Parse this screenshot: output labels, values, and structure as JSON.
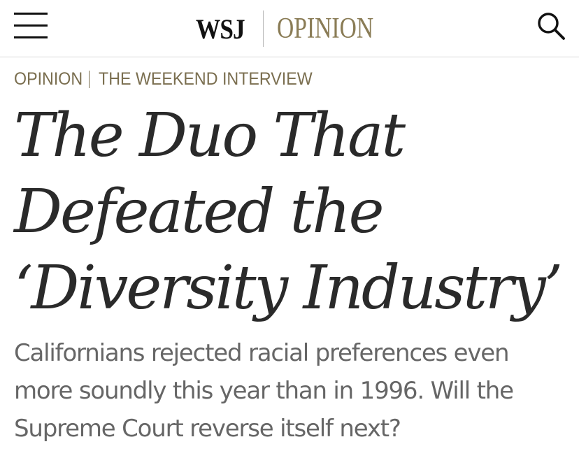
{
  "header": {
    "brand": "WSJ",
    "section": "OPINION",
    "menu_icon": "hamburger-menu-icon",
    "search_icon": "search-icon"
  },
  "breadcrumb": {
    "section": "OPINION",
    "column": "THE WEEKEND INTERVIEW"
  },
  "article": {
    "headline": "The Duo That Defeated the ‘Diversity Industry’",
    "dek": "Californians rejected racial preferences even more soundly this year than in 1996. Will the Supreme Court reverse itself next?"
  },
  "colors": {
    "accent": "#8a7c56",
    "headline": "#2a2a2a",
    "dek": "#666666",
    "divider": "#d9d9d9"
  }
}
